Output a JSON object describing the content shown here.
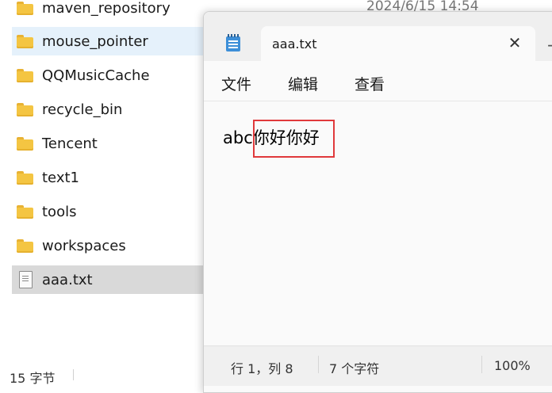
{
  "explorer": {
    "items": [
      {
        "name": "maven_repository",
        "type": "folder",
        "date": "2024/6/15 14:54"
      },
      {
        "name": "mouse_pointer",
        "type": "folder"
      },
      {
        "name": "QQMusicCache",
        "type": "folder"
      },
      {
        "name": "recycle_bin",
        "type": "folder"
      },
      {
        "name": "Tencent",
        "type": "folder"
      },
      {
        "name": "text1",
        "type": "folder"
      },
      {
        "name": "tools",
        "type": "folder"
      },
      {
        "name": "workspaces",
        "type": "folder"
      },
      {
        "name": "aaa.txt",
        "type": "text-file"
      }
    ],
    "status_count": "15 字节"
  },
  "notepad": {
    "tab_title": "aaa.txt",
    "close_glyph": "✕",
    "add_glyph": "+",
    "menu": [
      "文件",
      "编辑",
      "查看"
    ],
    "content": "abc你好你好",
    "status": {
      "position": "行 1，列 8",
      "char_count": "7 个字符",
      "zoom": "100%"
    }
  },
  "colors": {
    "highlight_border": "#e0393b",
    "hover_row": "#e5f1fb",
    "selected_row": "#d9d9d9",
    "folder": "#f4c542",
    "app_icon": "#3d8fd8"
  }
}
